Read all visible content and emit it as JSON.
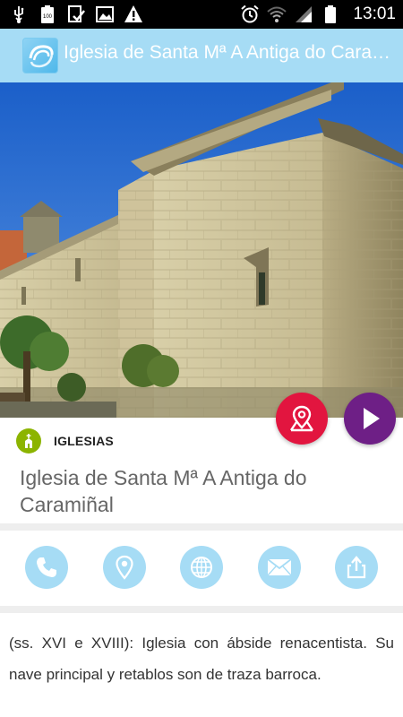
{
  "status_bar": {
    "time": "13:01",
    "battery_label": "100",
    "left_icons": [
      "usb-icon",
      "battery-full-icon",
      "download-check-icon",
      "image-icon",
      "warning-icon"
    ],
    "right_icons": [
      "alarm-icon",
      "wifi-icon",
      "signal-icon",
      "battery-icon"
    ]
  },
  "app_bar": {
    "title": "Iglesia de Santa Mª A Antiga do Caramiñal",
    "logo_icon": "app-logo-icon",
    "color": "#a6dcf5"
  },
  "hero": {
    "image_icon": "church-photo"
  },
  "fabs": {
    "map": {
      "icon": "map-marker-icon",
      "color": "#e2153f"
    },
    "play": {
      "icon": "play-icon",
      "color": "#6e1f86"
    }
  },
  "category": {
    "label": "IGLESIAS",
    "icon": "church-icon",
    "color": "#8cb400"
  },
  "place": {
    "title": "Iglesia de Santa Mª A Antiga do Caramiñal"
  },
  "actions": [
    {
      "name": "call",
      "icon": "phone-icon"
    },
    {
      "name": "location",
      "icon": "location-pin-icon"
    },
    {
      "name": "web",
      "icon": "globe-icon"
    },
    {
      "name": "mail",
      "icon": "envelope-icon"
    },
    {
      "name": "share",
      "icon": "share-icon"
    }
  ],
  "description": {
    "text": "(ss. XVI e XVIII): Iglesia con  ábside renacentista. Su nave principal y retablos son de traza barroca."
  }
}
